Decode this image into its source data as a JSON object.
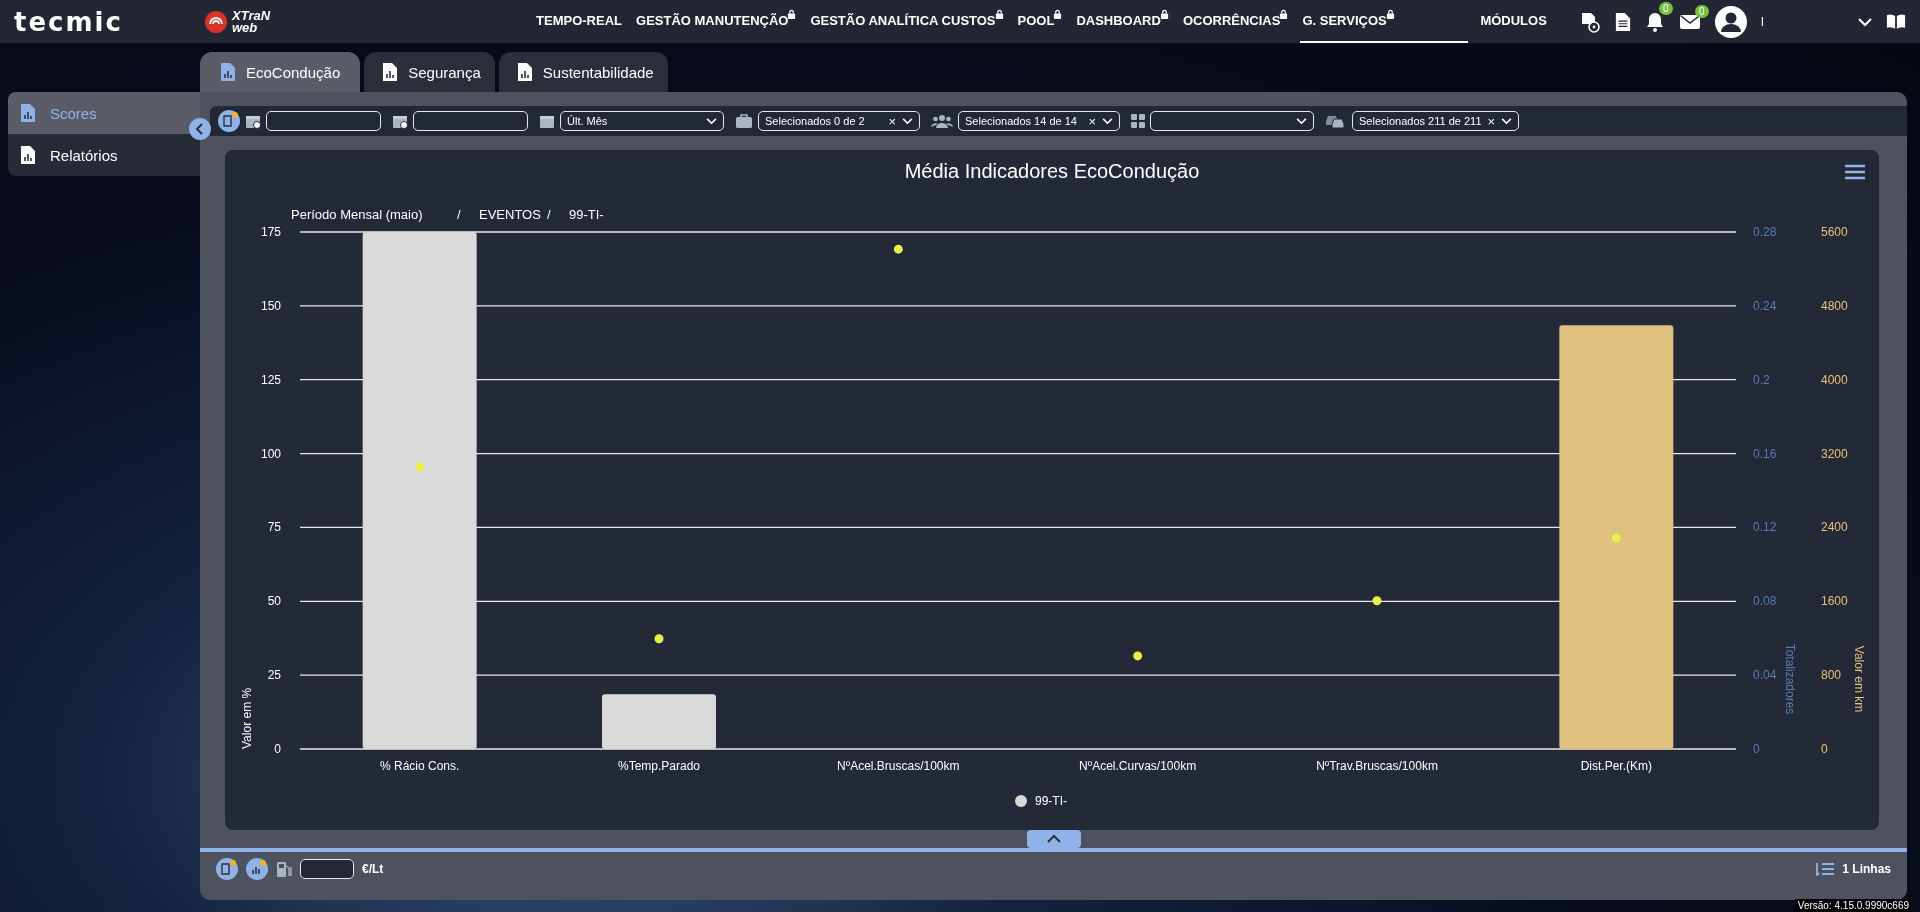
{
  "header": {
    "logo": "tecmic",
    "product_logo": [
      "XTraN",
      "web"
    ],
    "nav": [
      {
        "label": "TEMPO-REAL",
        "locked": false,
        "selected": false
      },
      {
        "label": "GESTÃO MANUTENÇÃO",
        "locked": true,
        "selected": false
      },
      {
        "label": "GESTÃO ANALÍTICA CUSTOS",
        "locked": true,
        "selected": false
      },
      {
        "label": "POOL",
        "locked": true,
        "selected": false
      },
      {
        "label": "DASHBOARD",
        "locked": true,
        "selected": false
      },
      {
        "label": "OCORRÊNCIAS",
        "locked": true,
        "selected": false
      },
      {
        "label": "G. SERVIÇOS",
        "locked": true,
        "selected": true
      },
      {
        "label": "MÓDULOS",
        "locked": false,
        "selected": false
      }
    ],
    "notifications_badge": "0",
    "messages_badge": "0",
    "user_name": "I"
  },
  "tabs": [
    {
      "label": "EcoCondução",
      "selected": true
    },
    {
      "label": "Segurança",
      "selected": false
    },
    {
      "label": "Sustentabilidade",
      "selected": false
    }
  ],
  "sidebar": {
    "items": [
      {
        "label": "Scores",
        "selected": true
      },
      {
        "label": "Relatórios",
        "selected": false
      }
    ]
  },
  "filters": [
    {
      "kind": "date"
    },
    {
      "kind": "date"
    },
    {
      "kind": "select",
      "value": "Últ. Mês"
    },
    {
      "kind": "multi",
      "value": "Selecionados 0 de 2",
      "clear": "×"
    },
    {
      "kind": "multi",
      "value": "Selecionados 14 de 14",
      "clear": "×"
    },
    {
      "kind": "select"
    },
    {
      "kind": "multi",
      "value": "Selecionados 211 de 211",
      "clear": "×"
    }
  ],
  "chart": {
    "breadcrumb": [
      "Período Mensal (maio)",
      "EVENTOS",
      "99-TI-"
    ],
    "separator": "/",
    "chart_data": {
      "type": "bar",
      "title": "Média Indicadores EcoCondução",
      "ylabel": "Valor em %",
      "categories": [
        "% Rácio Cons.",
        "%Temp.Parado",
        "NºAcel.Bruscas/100km",
        "NºAcel.Curvas/100km",
        "NºTrav.Bruscas/100km",
        "Dist.Per.(Km)"
      ],
      "grid": true,
      "ylim": [
        0,
        175
      ],
      "yticks": [
        0,
        25,
        50,
        75,
        100,
        125,
        150,
        175
      ],
      "y2label": "Totalizadores",
      "y2lim": [
        0,
        0.28
      ],
      "y2ticks": [
        0,
        0.04,
        0.08,
        0.12,
        0.16,
        0.2,
        0.24,
        0.28
      ],
      "y3label": "Valor em km",
      "y3lim": [
        0,
        5600
      ],
      "y3ticks": [
        0,
        800,
        1600,
        2400,
        3200,
        4000,
        4800,
        5600
      ],
      "series": [
        {
          "name": "99-TI-",
          "color": "#d9d9d9",
          "values": [
            175,
            18.5,
            null,
            null,
            null,
            null
          ]
        },
        {
          "color": "#e0c07e",
          "axis": "y3",
          "values": [
            null,
            null,
            null,
            null,
            null,
            4590
          ]
        },
        {
          "color": "#e8f04a",
          "type": "scatter",
          "values": [
            95.4,
            37.3,
            169.2,
            31.5,
            50.2,
            71.3
          ]
        }
      ]
    }
  },
  "footer": {
    "unit": "€/Lt",
    "rows": "1 Linhas"
  },
  "version": "Versão: 4.15.0.9990c669"
}
